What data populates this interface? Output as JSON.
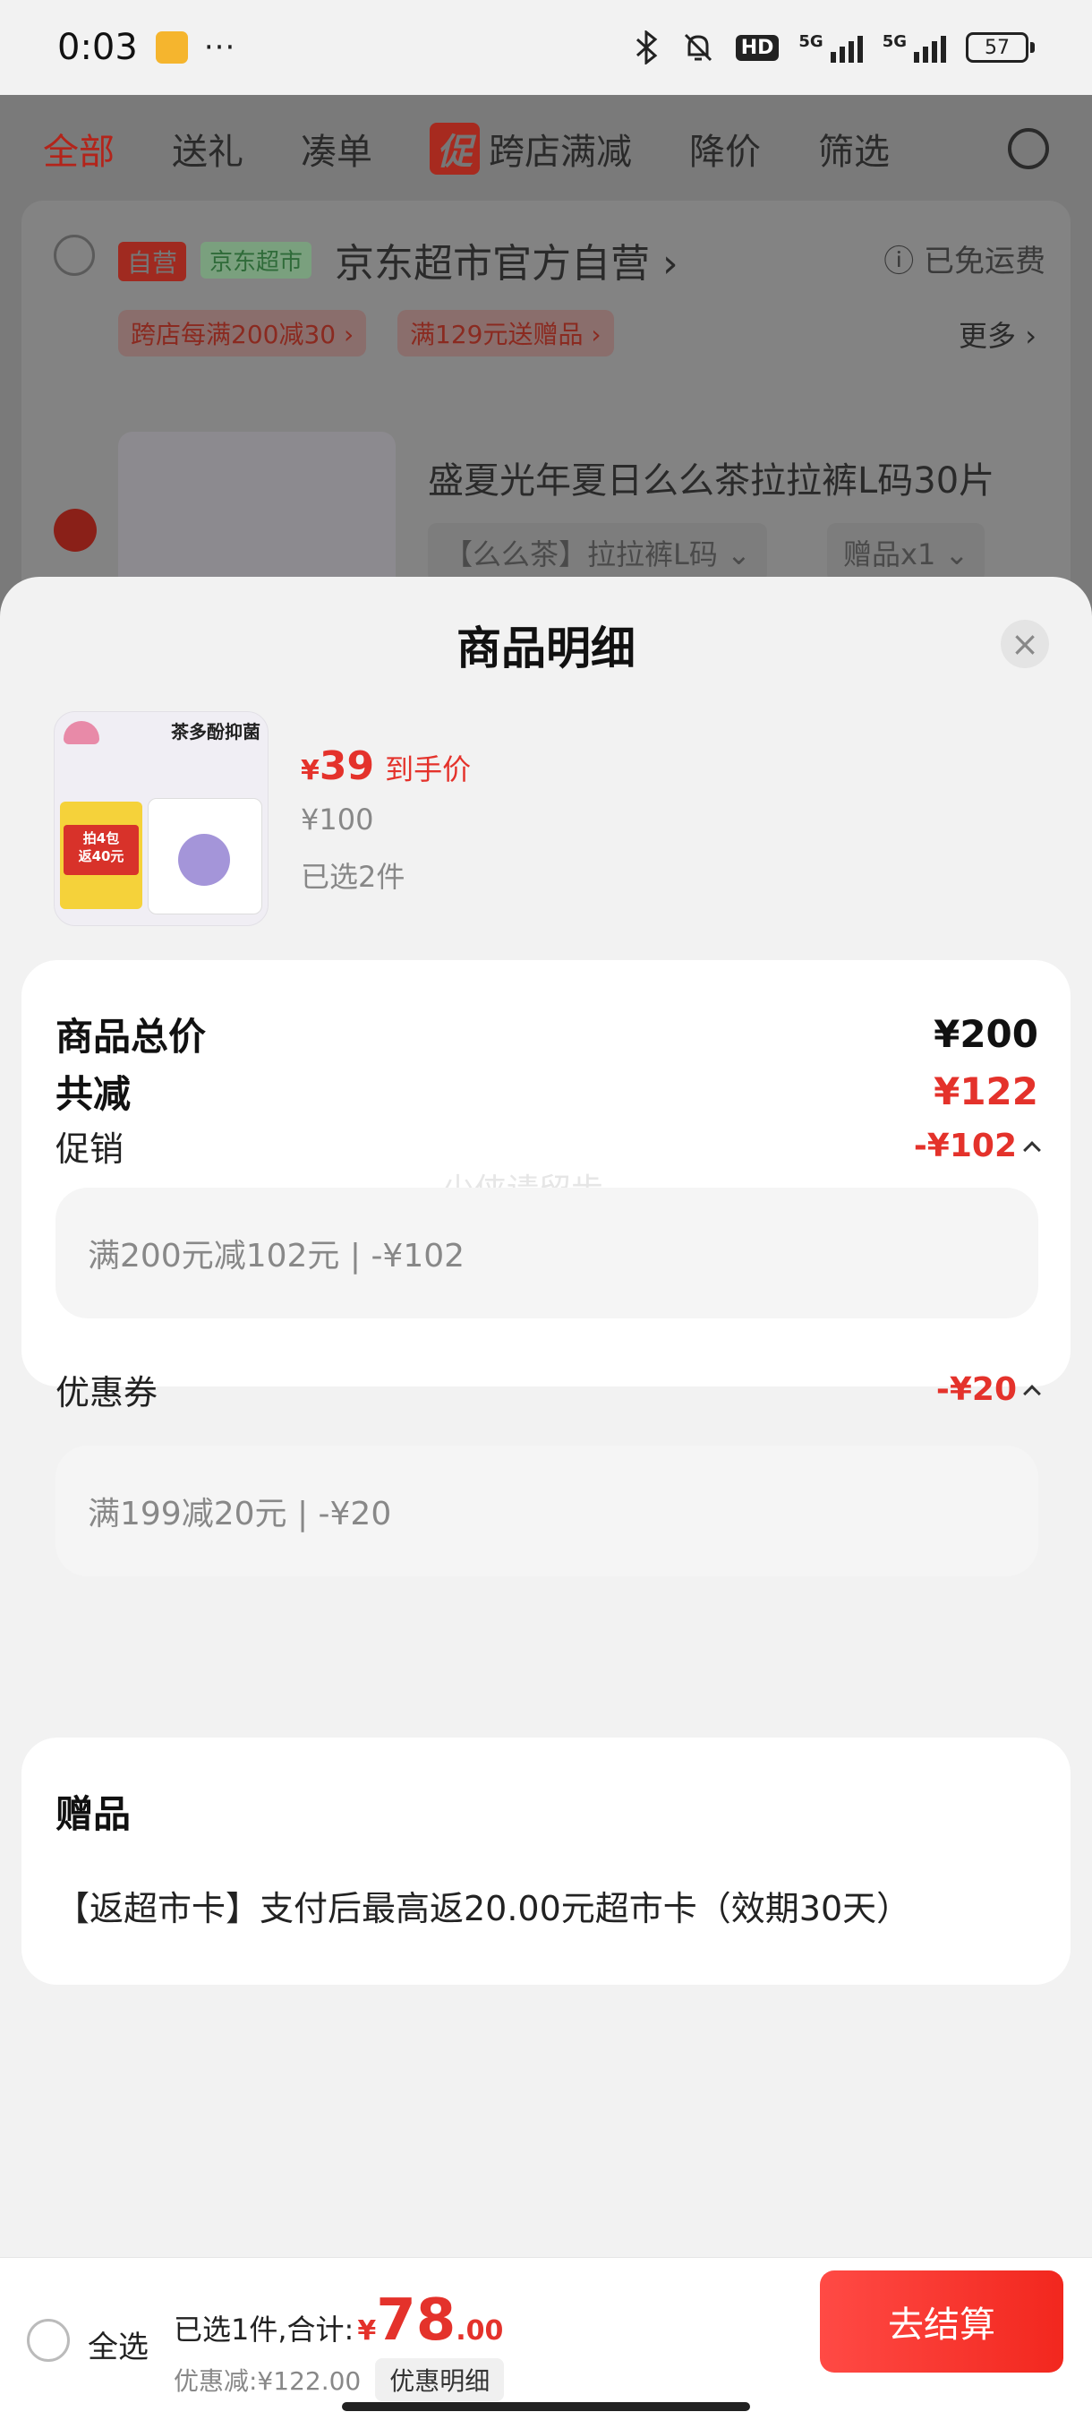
{
  "status_bar": {
    "time": "0:03",
    "dots": "···",
    "hd_label": "HD",
    "net1": "5G",
    "net2": "5G",
    "battery": "57"
  },
  "background_page": {
    "tabs": [
      "全部",
      "送礼",
      "凑单",
      "跨店满减",
      "降价",
      "筛选"
    ],
    "promo_tag": "促",
    "store_badge_self": "自营",
    "store_badge_jd": "京东超市",
    "store_name": "京东超市官方自营 ›",
    "free_shipping": "ⓘ 已免运费",
    "promo_chip_1": "跨店每满200减30 ›",
    "promo_chip_2": "满129元送赠品 ›",
    "more": "更多 ›",
    "product_title": "盛夏光年夏日么么茶拉拉裤L码30片",
    "spec": "【么么茶】拉拉裤L码 ⌄",
    "gift": "赠品x1 ⌄"
  },
  "sheet": {
    "title": "商品明细",
    "close_icon": "close-icon"
  },
  "product": {
    "thumb_headline": "茶多酚抑菌",
    "thumb_promo": "拍4包\n返40元",
    "price_symbol": "¥",
    "price": "39",
    "price_label": "到手价",
    "original_price": "¥100",
    "selected_count": "已选2件"
  },
  "summary": {
    "total_label": "商品总价",
    "total_value": "¥200",
    "reduce_label": "共减",
    "reduce_value": "¥122",
    "watermark": "少侠请留步",
    "promo_label": "促销",
    "promo_value": "-¥102",
    "promo_detail": "满200元减102元 | -¥102",
    "coupon_label": "优惠券",
    "coupon_value": "-¥20",
    "coupon_detail": "满199减20元 | -¥20"
  },
  "gift_section": {
    "title": "赠品",
    "text": "【返超市卡】支付后最高返20.00元超市卡（效期30天）"
  },
  "bottom_bar": {
    "select_all": "全选",
    "total_prefix": "已选1件,合计:",
    "total_symbol": "¥",
    "total_int": "78",
    "total_dec": ".00",
    "discount": "优惠减:¥122.00",
    "detail_button": "优惠明细",
    "checkout_button": "去结算"
  },
  "colors": {
    "accent_red": "#e4322b",
    "sheet_bg": "#f2f2f2",
    "card_bg": "#ffffff"
  }
}
